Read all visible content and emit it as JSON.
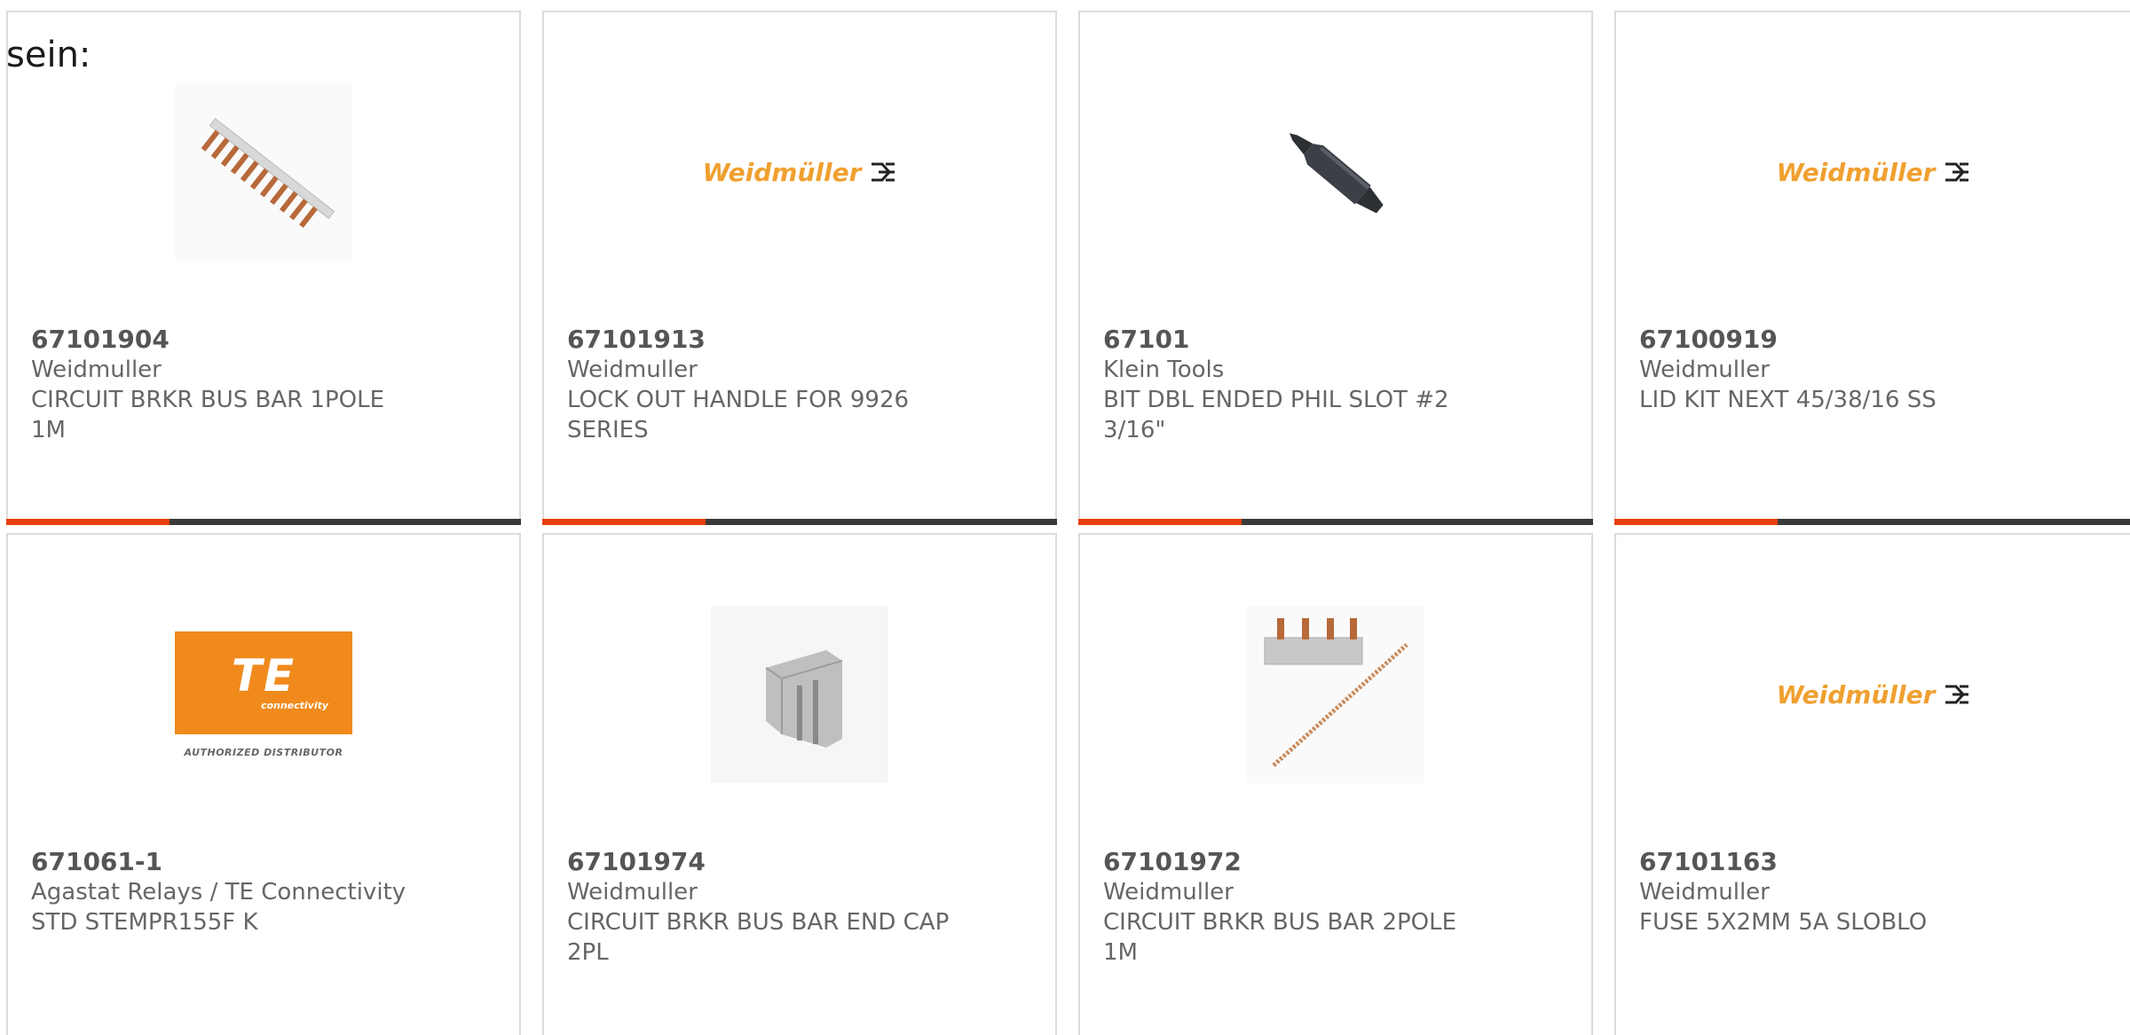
{
  "lead_text": "sein:",
  "accent_color": "#e8400c",
  "bar_color": "#3a3a3a",
  "products": [
    {
      "part_number": "67101904",
      "manufacturer": "Weidmuller",
      "description_line1": "CIRCUIT BRKR BUS BAR 1POLE",
      "description_line2": "1M",
      "image": "bus-bar-1pole-image"
    },
    {
      "part_number": "67101913",
      "manufacturer": "Weidmuller",
      "description_line1": "LOCK OUT HANDLE FOR 9926",
      "description_line2": "SERIES",
      "image": "weidmuller-logo",
      "logo_text": "Weidmüller"
    },
    {
      "part_number": "67101",
      "manufacturer": "Klein Tools",
      "description_line1": "BIT DBL ENDED PHIL SLOT #2",
      "description_line2": "3/16\"",
      "image": "screwdriver-bit-image"
    },
    {
      "part_number": "67100919",
      "manufacturer": "Weidmuller",
      "description_line1": "LID KIT NEXT 45/38/16 SS",
      "description_line2": "",
      "image": "weidmuller-logo",
      "logo_text": "Weidmüller"
    },
    {
      "part_number": "671061-1",
      "manufacturer": "Agastat Relays / TE Connectivity",
      "description_line1": "STD STEMPR155F K",
      "description_line2": "",
      "image": "te-connectivity-logo",
      "logo_mark": "TE",
      "logo_sub": "connectivity",
      "logo_caption": "AUTHORIZED DISTRIBUTOR"
    },
    {
      "part_number": "67101974",
      "manufacturer": "Weidmuller",
      "description_line1": "CIRCUIT BRKR BUS BAR END CAP",
      "description_line2": "2PL",
      "image": "end-cap-image"
    },
    {
      "part_number": "67101972",
      "manufacturer": "Weidmuller",
      "description_line1": "CIRCUIT BRKR BUS BAR 2POLE",
      "description_line2": "1M",
      "image": "bus-bar-2pole-image"
    },
    {
      "part_number": "67101163",
      "manufacturer": "Weidmuller",
      "description_line1": "FUSE 5X2MM 5A SLOBLO",
      "description_line2": "",
      "image": "weidmuller-logo",
      "logo_text": "Weidmüller"
    }
  ]
}
